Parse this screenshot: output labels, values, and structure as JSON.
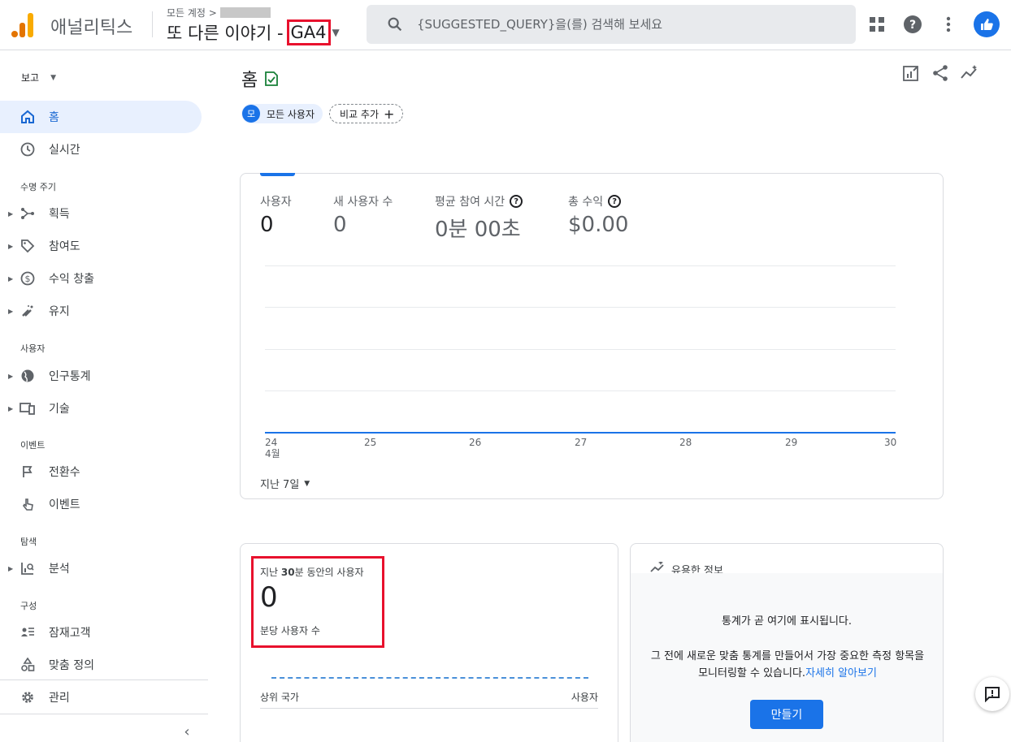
{
  "header": {
    "app_name": "애널리틱스",
    "breadcrumb_label": "모든 계정 >",
    "property_name": "또 다른 이야기 -",
    "property_suffix": "GA4",
    "search_placeholder": "{SUGGESTED_QUERY}을(를) 검색해 보세요"
  },
  "sidebar": {
    "reports_label": "보고",
    "home": "홈",
    "realtime": "실시간",
    "section_lifecycle": "수명 주기",
    "acquisition": "획득",
    "engagement": "참여도",
    "monetization": "수익 창출",
    "retention": "유지",
    "section_user": "사용자",
    "demographics": "인구통계",
    "tech": "기술",
    "section_events": "이벤트",
    "conversions": "전환수",
    "events": "이벤트",
    "section_explore": "탐색",
    "analysis": "분석",
    "section_configure": "구성",
    "audiences": "잠재고객",
    "custom_definitions": "맞춤 정의",
    "admin": "관리"
  },
  "main": {
    "title": "홈",
    "chip_badge": "모",
    "chip_all_users": "모든 사용자",
    "chip_add_compare": "비교 추가",
    "metrics": [
      {
        "label": "사용자",
        "value": "0"
      },
      {
        "label": "새 사용자 수",
        "value": "0"
      },
      {
        "label": "평균 참여 시간",
        "value": "0분 00초"
      },
      {
        "label": "총 수익",
        "value": "$0.00"
      }
    ],
    "x_ticks": [
      "24",
      "25",
      "26",
      "27",
      "28",
      "29",
      "30"
    ],
    "x_month": "4월",
    "date_range": "지난 7일"
  },
  "realtime": {
    "title_prefix": "지난",
    "title_bold": "30",
    "title_suffix": "분 동안의 사용자",
    "value": "0",
    "subtitle": "분당 사용자 수",
    "col_country": "상위 국가",
    "col_users": "사용자"
  },
  "insights": {
    "title": "유용한 정보",
    "main_text": "통계가 곧 여기에 표시됩니다.",
    "desc": "그 전에 새로운 맞춤 통계를 만들어서 가장 중요한 측정 항목을 모니터링할 수 있습니다.",
    "link": "자세히 알아보기",
    "create_button": "만들기"
  }
}
